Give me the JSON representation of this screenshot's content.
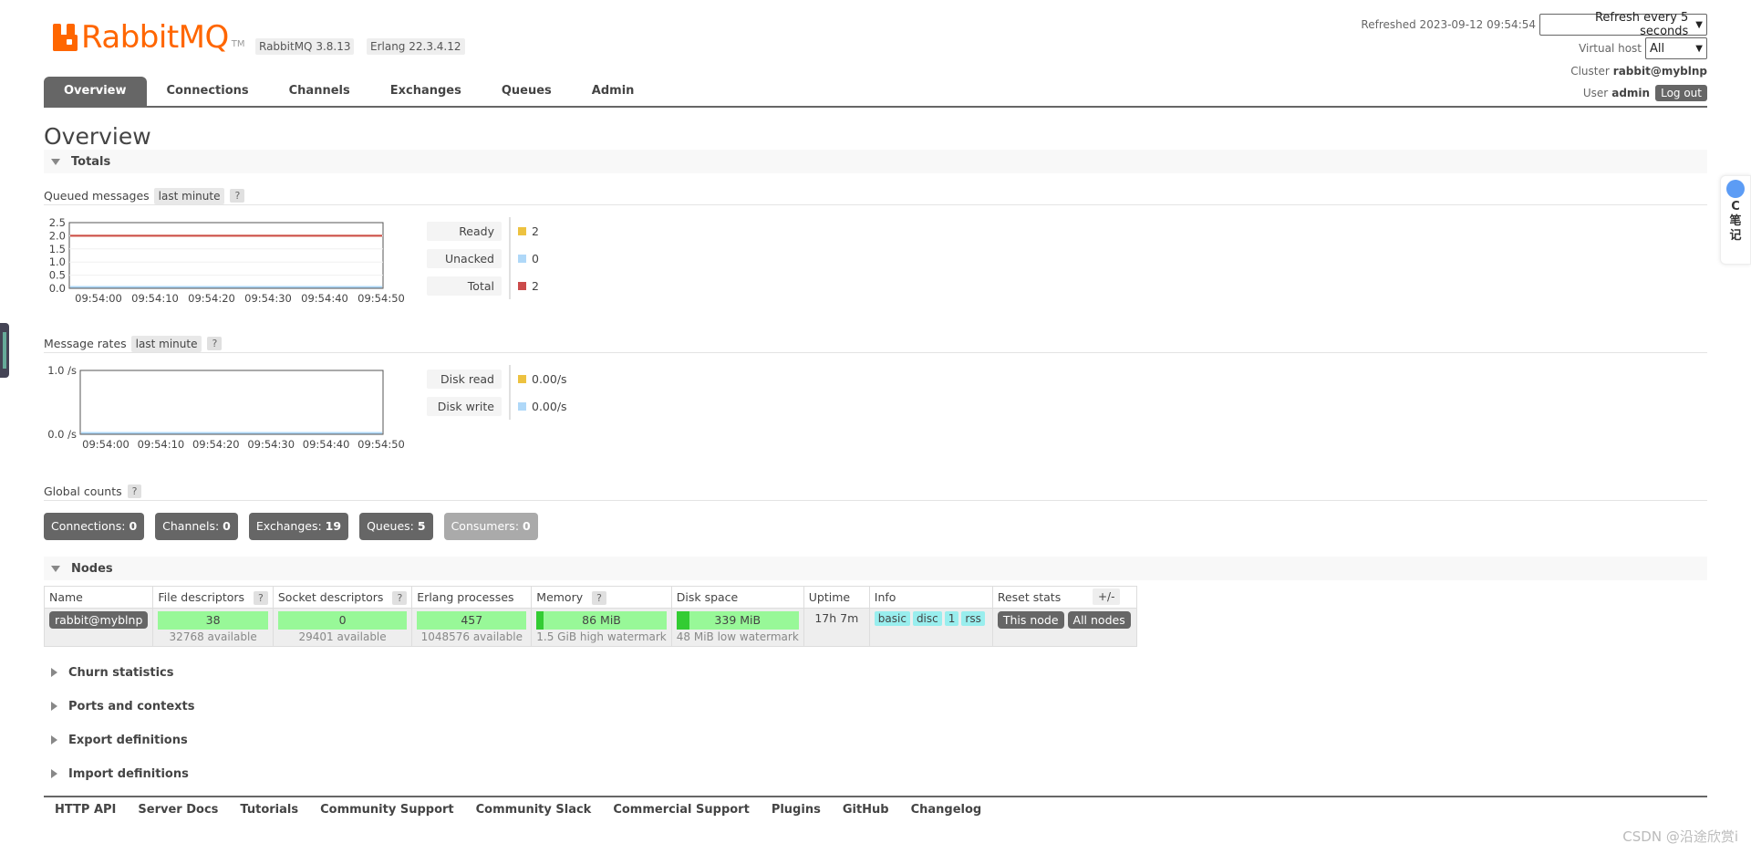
{
  "brand": {
    "name": "RabbitMQ",
    "tm": "TM"
  },
  "versions": [
    "RabbitMQ 3.8.13",
    "Erlang 22.3.4.12"
  ],
  "header": {
    "refreshed_label": "Refreshed 2023-09-12 09:54:54",
    "refresh_select": "Refresh every 5 seconds",
    "vhost_label": "Virtual host",
    "vhost_select": "All",
    "cluster_label": "Cluster",
    "cluster_name": "rabbit@myblnp",
    "user_label": "User",
    "user_name": "admin",
    "logout": "Log out"
  },
  "tabs": [
    "Overview",
    "Connections",
    "Channels",
    "Exchanges",
    "Queues",
    "Admin"
  ],
  "page_title": "Overview",
  "totals": {
    "heading": "Totals",
    "queued": {
      "label": "Queued messages",
      "range": "last minute",
      "help": "?",
      "legend": [
        {
          "label": "Ready",
          "value": "2",
          "color": "#edc240"
        },
        {
          "label": "Unacked",
          "value": "0",
          "color": "#afd8f8"
        },
        {
          "label": "Total",
          "value": "2",
          "color": "#cb4b4b"
        }
      ]
    },
    "rates": {
      "label": "Message rates",
      "range": "last minute",
      "help": "?",
      "legend": [
        {
          "label": "Disk read",
          "value": "0.00/s",
          "color": "#edc240"
        },
        {
          "label": "Disk write",
          "value": "0.00/s",
          "color": "#afd8f8"
        }
      ]
    },
    "global": {
      "label": "Global counts",
      "help": "?",
      "items": [
        {
          "name": "Connections:",
          "value": "0"
        },
        {
          "name": "Channels:",
          "value": "0"
        },
        {
          "name": "Exchanges:",
          "value": "19"
        },
        {
          "name": "Queues:",
          "value": "5"
        },
        {
          "name": "Consumers:",
          "value": "0"
        }
      ]
    }
  },
  "chart_data": [
    {
      "type": "line",
      "x": [
        "09:54:00",
        "09:54:10",
        "09:54:20",
        "09:54:30",
        "09:54:40",
        "09:54:50"
      ],
      "y_ticks": [
        "0.0",
        "0.5",
        "1.0",
        "1.5",
        "2.0",
        "2.5"
      ],
      "ylim": [
        0,
        2.5
      ],
      "series": [
        {
          "name": "Ready",
          "color": "#edc240",
          "values": [
            2,
            2,
            2,
            2,
            2,
            2
          ]
        },
        {
          "name": "Unacked",
          "color": "#afd8f8",
          "values": [
            0,
            0,
            0,
            0,
            0,
            0
          ]
        },
        {
          "name": "Total",
          "color": "#cb4b4b",
          "values": [
            2,
            2,
            2,
            2,
            2,
            2
          ]
        }
      ]
    },
    {
      "type": "line",
      "x": [
        "09:54:00",
        "09:54:10",
        "09:54:20",
        "09:54:30",
        "09:54:40",
        "09:54:50"
      ],
      "y_ticks": [
        "0.0 /s",
        "1.0 /s"
      ],
      "ylim": [
        0,
        1
      ],
      "series": [
        {
          "name": "Disk read",
          "color": "#edc240",
          "values": [
            0,
            0,
            0,
            0,
            0,
            0
          ]
        },
        {
          "name": "Disk write",
          "color": "#afd8f8",
          "values": [
            0,
            0,
            0,
            0,
            0,
            0
          ]
        }
      ]
    }
  ],
  "nodes": {
    "heading": "Nodes",
    "plus_minus": "+/-",
    "columns": [
      "Name",
      "File descriptors",
      "Socket descriptors",
      "Erlang processes",
      "Memory",
      "Disk space",
      "Uptime",
      "Info",
      "Reset stats"
    ],
    "row": {
      "name": "rabbit@myblnp",
      "fd": "38",
      "fd_sub": "32768 available",
      "sockets": "0",
      "sockets_sub": "29401 available",
      "procs": "457",
      "procs_sub": "1048576 available",
      "memory": "86 MiB",
      "memory_sub": "1.5 GiB high watermark",
      "disk": "339 MiB",
      "disk_sub": "48 MiB low watermark",
      "uptime": "17h 7m",
      "info": [
        "basic",
        "disc",
        "1",
        "rss"
      ],
      "reset_this": "This node",
      "reset_all": "All nodes"
    }
  },
  "collapsed_sections": [
    "Churn statistics",
    "Ports and contexts",
    "Export definitions",
    "Import definitions"
  ],
  "footer": [
    "HTTP API",
    "Server Docs",
    "Tutorials",
    "Community Support",
    "Community Slack",
    "Commercial Support",
    "Plugins",
    "GitHub",
    "Changelog"
  ],
  "watermark": "CSDN @沿途欣赏i",
  "side_widget": [
    "C",
    "笔",
    "记"
  ]
}
